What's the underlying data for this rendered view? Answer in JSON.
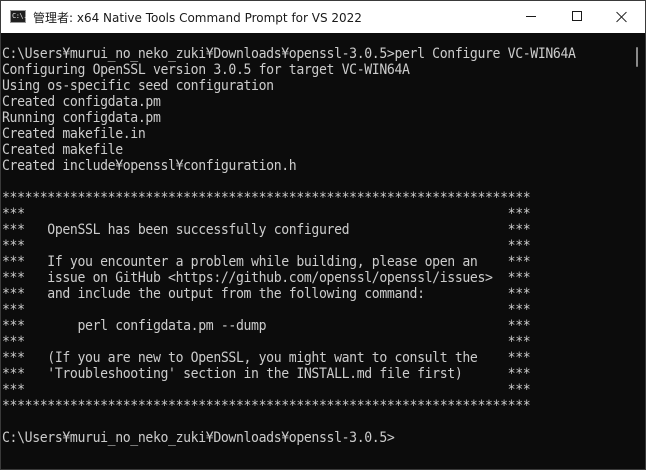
{
  "window": {
    "title": "管理者: x64 Native Tools Command Prompt for VS 2022",
    "icon": "cmd-icon",
    "icon_text": "C:\\."
  },
  "console": {
    "lines": [
      "C:\\Users¥murui_no_neko_zuki¥Downloads¥openssl-3.0.5>perl Configure VC-WIN64A",
      "Configuring OpenSSL version 3.0.5 for target VC-WIN64A",
      "Using os-specific seed configuration",
      "Created configdata.pm",
      "Running configdata.pm",
      "Created makefile.in",
      "Created makefile",
      "Created include¥openssl¥configuration.h",
      "",
      "**********************************************************************",
      "***                                                                ***",
      "***   OpenSSL has been successfully configured                     ***",
      "***                                                                ***",
      "***   If you encounter a problem while building, please open an    ***",
      "***   issue on GitHub <https://github.com/openssl/openssl/issues>  ***",
      "***   and include the output from the following command:           ***",
      "***                                                                ***",
      "***       perl configdata.pm --dump                                ***",
      "***                                                                ***",
      "***   (If you are new to OpenSSL, you might want to consult the    ***",
      "***   'Troubleshooting' section in the INSTALL.md file first)      ***",
      "***                                                                ***",
      "**********************************************************************",
      "",
      "C:\\Users¥murui_no_neko_zuki¥Downloads¥openssl-3.0.5>"
    ]
  },
  "colors": {
    "background": "#0c0c0c",
    "text": "#cccccc",
    "titlebar": "#ffffff"
  }
}
